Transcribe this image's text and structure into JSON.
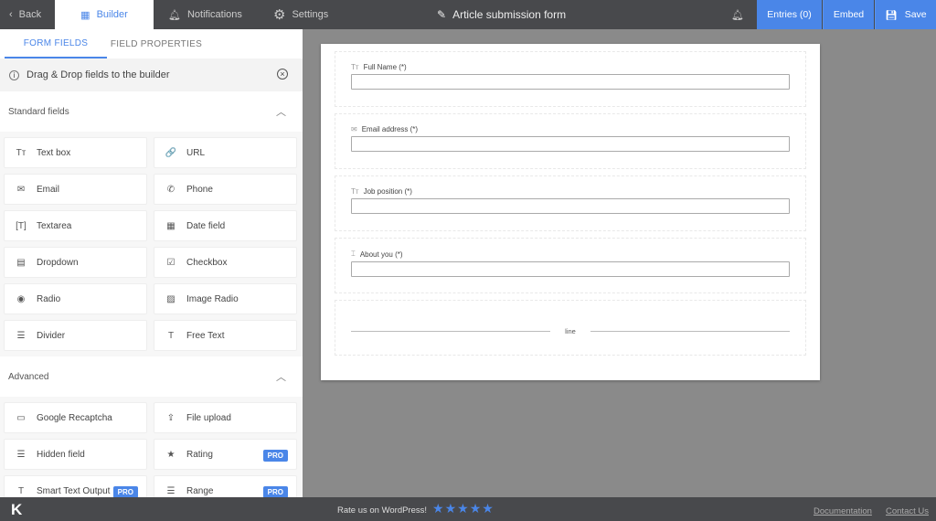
{
  "topbar": {
    "back": "Back",
    "builder": "Builder",
    "notifications": "Notifications",
    "settings": "Settings",
    "form_title": "Article submission form",
    "entries": "Entries (0)",
    "embed": "Embed",
    "save": "Save"
  },
  "sidebar": {
    "tabs": [
      "FORM FIELDS",
      "FIELD PROPERTIES"
    ],
    "notice": "Drag & Drop fields to the builder",
    "standard_title": "Standard fields",
    "standard": [
      {
        "label": "Text box",
        "icon": "text-box-icon",
        "glyph": "Tт"
      },
      {
        "label": "URL",
        "icon": "link-icon",
        "glyph": "🔗"
      },
      {
        "label": "Email",
        "icon": "email-icon",
        "glyph": "✉"
      },
      {
        "label": "Phone",
        "icon": "phone-icon",
        "glyph": "✆"
      },
      {
        "label": "Textarea",
        "icon": "textarea-icon",
        "glyph": "[T]"
      },
      {
        "label": "Date field",
        "icon": "calendar-icon",
        "glyph": "▦"
      },
      {
        "label": "Dropdown",
        "icon": "dropdown-icon",
        "glyph": "▤"
      },
      {
        "label": "Checkbox",
        "icon": "checkbox-icon",
        "glyph": "☑"
      },
      {
        "label": "Radio",
        "icon": "radio-icon",
        "glyph": "◉"
      },
      {
        "label": "Image Radio",
        "icon": "image-radio-icon",
        "glyph": "▨"
      },
      {
        "label": "Divider",
        "icon": "divider-icon",
        "glyph": "☰"
      },
      {
        "label": "Free Text",
        "icon": "free-text-icon",
        "glyph": "T"
      }
    ],
    "advanced_title": "Advanced",
    "advanced": [
      {
        "label": "Google Recaptcha",
        "icon": "recaptcha-icon",
        "glyph": "▭"
      },
      {
        "label": "File upload",
        "icon": "upload-icon",
        "glyph": "⇪"
      },
      {
        "label": "Hidden field",
        "icon": "hidden-field-icon",
        "glyph": "☰"
      },
      {
        "label": "Rating",
        "icon": "star-icon",
        "glyph": "★",
        "badge": "PRO"
      },
      {
        "label": "Smart Text Output",
        "icon": "smart-text-icon",
        "glyph": "T",
        "badge": "PRO"
      },
      {
        "label": "Range",
        "icon": "range-icon",
        "glyph": "☰",
        "badge": "PRO"
      }
    ]
  },
  "form": {
    "fields": [
      {
        "label": "Full Name (*)",
        "icon": "text-box-icon",
        "glyph": "Tт"
      },
      {
        "label": "Email address (*)",
        "icon": "email-icon",
        "glyph": "✉"
      },
      {
        "label": "Job position (*)",
        "icon": "text-box-icon",
        "glyph": "Tт"
      },
      {
        "label": "About you (*)",
        "icon": "textarea-icon",
        "glyph": "⌶"
      }
    ],
    "divider_label": "line"
  },
  "footer": {
    "logo": "K",
    "rate": "Rate us on WordPress!",
    "stars": "★★★★★",
    "rating": 5,
    "documentation": "Documentation",
    "contact": "Contact Us"
  }
}
